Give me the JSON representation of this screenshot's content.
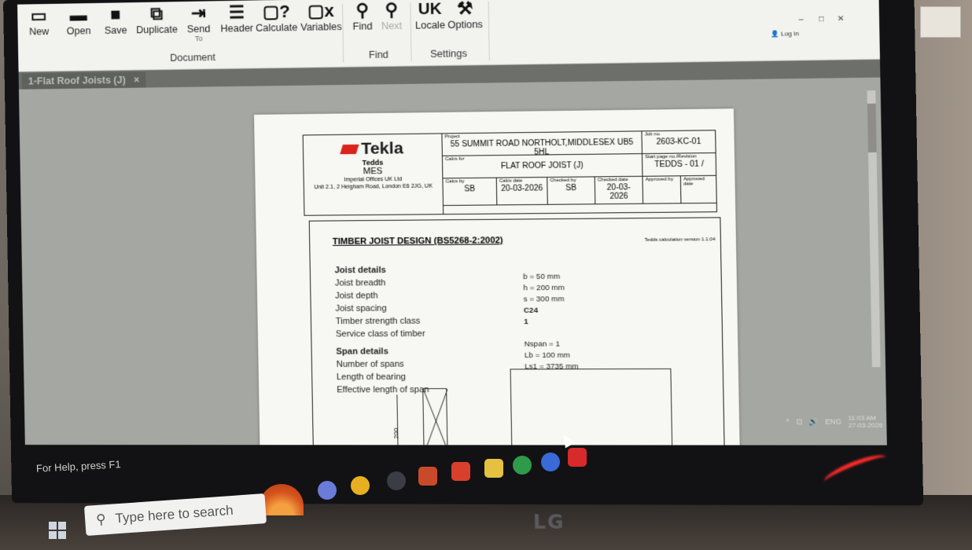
{
  "ribbon": {
    "document_buttons": [
      {
        "label": "New",
        "icon": "new-document-icon"
      },
      {
        "label": "Open",
        "icon": "folder-open-icon"
      },
      {
        "label": "Save",
        "icon": "save-icon"
      },
      {
        "label": "Duplicate",
        "icon": "duplicate-icon"
      },
      {
        "label": "Send",
        "icon": "send-icon",
        "sublabel": "To"
      },
      {
        "label": "Header",
        "icon": "header-icon"
      },
      {
        "label": "Calculate",
        "icon": "calculate-icon"
      },
      {
        "label": "Variables",
        "icon": "variables-icon"
      }
    ],
    "document_group": "Document",
    "find_buttons": [
      {
        "label": "Find",
        "icon": "search-icon"
      },
      {
        "label": "Next",
        "icon": "search-next-icon"
      }
    ],
    "find_group": "Find",
    "settings_buttons": [
      {
        "label": "Locale",
        "icon_text": "UK"
      },
      {
        "label": "Options",
        "icon": "wrench-icon"
      }
    ],
    "settings_group": "Settings",
    "login": "Log in"
  },
  "doc_tab": {
    "label": "1-Flat Roof Joists (J)",
    "close": "×"
  },
  "header": {
    "brand": "Tekla",
    "product": "Tedds",
    "company": "MES",
    "office": "Imperial Offices UK Ltd",
    "address": "Unit 2.1, 2 Heigham Road, London E6 2JG, UK",
    "project_label": "Project",
    "project": "55 SUMMIT ROAD NORTHOLT,MIDDLESEX UB5 5HL",
    "job_label": "Job no.",
    "job": "2603-KC-01",
    "calcs_for_label": "Calcs for",
    "calcs_for": "FLAT ROOF JOIST (J)",
    "start_page_label": "Start page no./Revision",
    "start_page": "TEDDS - 01 /",
    "calcs_by_label": "Calcs by",
    "calcs_by": "SB",
    "calcs_date_label": "Calcs date",
    "calcs_date": "20-03-2026",
    "checked_by_label": "Checked by",
    "checked_by": "SB",
    "checked_date_label": "Checked date",
    "checked_date": "20-03-2026",
    "approved_by_label": "Approved by",
    "approved_date_label": "Approved date"
  },
  "calc": {
    "title": "TIMBER JOIST DESIGN (BS5268-2:2002)",
    "version": "Tedds calculation version 1.1.04",
    "joist_heading": "Joist details",
    "joist_rows": [
      {
        "label": "Joist breadth",
        "value": "b = 50 mm"
      },
      {
        "label": "Joist depth",
        "value": "h = 200 mm"
      },
      {
        "label": "Joist spacing",
        "value": "s = 300 mm"
      },
      {
        "label": "Timber strength class",
        "value": "C24"
      },
      {
        "label": "Service class of timber",
        "value": "1"
      }
    ],
    "span_heading": "Span details",
    "span_rows": [
      {
        "label": "Number of spans",
        "value": "Nspan = 1"
      },
      {
        "label": "Length of bearing",
        "value": "Lb = 100 mm"
      },
      {
        "label": "Effective length of span",
        "value": "Ls1 = 3735 mm"
      }
    ],
    "sketch_dim": "200"
  },
  "tray": {
    "lang": "ENG",
    "time": "11:03 AM",
    "date": "27-03-2026"
  },
  "statusbar": {
    "help": "For Help, press F1"
  },
  "taskbar": {
    "search_placeholder": "Type here to search"
  },
  "monitor_brand": "LG"
}
